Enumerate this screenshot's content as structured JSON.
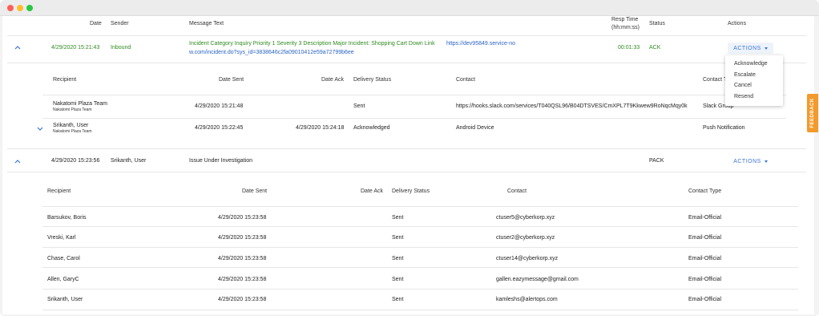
{
  "window": {
    "controls": [
      "close",
      "minimize",
      "zoom"
    ]
  },
  "header": {
    "date": "Date",
    "sender": "Sender",
    "message_text": "Message Text",
    "resp_time": "Resp Time",
    "resp_time_unit": "(hh:mm:ss)",
    "status": "Status",
    "actions": "Actions"
  },
  "messages": [
    {
      "date": "4/29/2020 15:21:43",
      "sender": "Inbound",
      "text": "Incident Category Inquiry Priority 1 Severity 3 Description Major Incident: Shopping Cart Down Link",
      "link_part1": "https://dev95849.service-no",
      "link_part2": "w.com/incident.do?sys_id=3838646c2fa09010412e59a72799b6ee",
      "resp_time": "00:01:33",
      "status": "ACK",
      "actions_label": "ACTIONS",
      "delivery_headers": {
        "recipient": "Recipient",
        "date_sent": "Date Sent",
        "date_ack": "Date Ack",
        "delivery_status": "Delivery Status",
        "contact": "Contact",
        "contact_type": "Contact T"
      },
      "deliveries": [
        {
          "recipient": "Nakatomi Plaza Team",
          "recipient_sub": "Nakatomi Plaza Team",
          "date_sent": "4/29/2020 15:21:48",
          "date_ack": "",
          "status": "Sent",
          "contact": "https://hooks.slack.com/services/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",
          "contact_type": "Slack Group"
        },
        {
          "recipient": "Srikanth, User",
          "recipient_sub": "Nakatomi Plaza Team",
          "date_sent": "4/29/2020 15:22:45",
          "date_ack": "4/29/2020 15:24:18",
          "status": "Acknowledged",
          "contact": "Android Device",
          "contact_type": "Push Notification"
        }
      ]
    },
    {
      "date": "4/29/2020 15:23:56",
      "sender": "Srikanth, User",
      "text": "Issue Under Investigation",
      "status": "PACK",
      "actions_label": "ACTIONS",
      "delivery_headers": {
        "recipient": "Recipient",
        "date_sent": "Date Sent",
        "date_ack": "Date Ack",
        "delivery_status": "Delivery Status",
        "contact": "Contact",
        "contact_type": "Contact Type"
      },
      "deliveries": [
        {
          "recipient": "Barsukov, Boris",
          "date_sent": "4/29/2020 15:23:58",
          "status": "Sent",
          "contact": "ctuser5@cyberkorp.xyz",
          "contact_type": "Email-Official"
        },
        {
          "recipient": "Vreski, Karl",
          "date_sent": "4/29/2020 15:23:58",
          "status": "Sent",
          "contact": "ctuser2@cyberkorp.xyz",
          "contact_type": "Email-Official"
        },
        {
          "recipient": "Chase, Carol",
          "date_sent": "4/29/2020 15:23:58",
          "status": "Sent",
          "contact": "ctuser14@cyberkorp.xyz",
          "contact_type": "Email-Official"
        },
        {
          "recipient": "Allen, GaryC",
          "date_sent": "4/29/2020 15:23:58",
          "status": "Sent",
          "contact": "gallen.eazymessage@gmail.com",
          "contact_type": "Email-Official"
        },
        {
          "recipient": "Srikanth, User",
          "date_sent": "4/29/2020 15:23:58",
          "status": "Sent",
          "contact": "kamleshs@alertops.com",
          "contact_type": "Email-Official"
        }
      ]
    }
  ],
  "actions_menu": [
    "Acknowledge",
    "Escalate",
    "Cancel",
    "Resend"
  ],
  "feedback_label": "FEEDBACK",
  "colors": {
    "accent": "#3a76d6",
    "green": "#2e8b1f",
    "feedback": "#f39a2c"
  }
}
